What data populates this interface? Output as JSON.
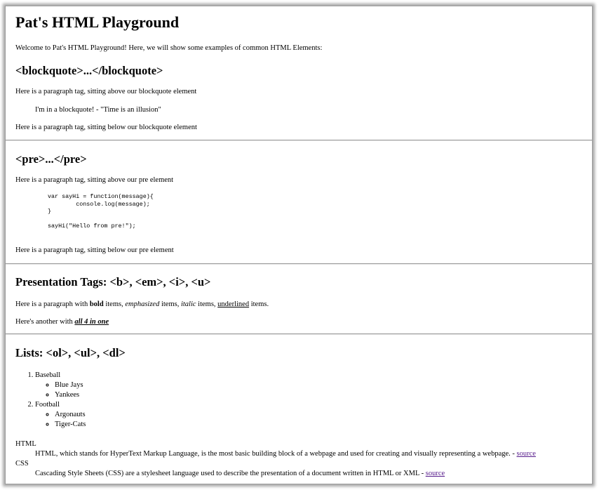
{
  "page": {
    "title": "Pat's HTML Playground",
    "intro": "Welcome to Pat's HTML Playground! Here, we will show some examples of common HTML Elements:"
  },
  "blockquote_section": {
    "heading": "<blockquote>...</blockquote>",
    "above": "Here is a paragraph tag, sitting above our blockquote element",
    "quote": "I'm in a blockquote! - \"Time is an illusion\"",
    "below": "Here is a paragraph tag, sitting below our blockquote element"
  },
  "pre_section": {
    "heading": "<pre>...</pre>",
    "above": "Here is a paragraph tag, sitting above our pre element",
    "code": "var sayHi = function(message){\n        console.log(message);\n}\n\nsayHi(\"Hello from pre!\");",
    "below": "Here is a paragraph tag, sitting below our pre element"
  },
  "presentation_section": {
    "heading": "Presentation Tags: <b>, <em>, <i>, <u>",
    "p1_start": "Here is a paragraph with ",
    "p1_bold": "bold",
    "p1_after_bold": " items, ",
    "p1_em": "emphasized",
    "p1_after_em": " items, ",
    "p1_italic": "italic",
    "p1_after_italic": " items, ",
    "p1_underline": "underlined",
    "p1_end": " items.",
    "p2_start": "Here's another with ",
    "p2_all": "all 4 in one"
  },
  "lists_section": {
    "heading": "Lists: <ol>, <ul>, <dl>",
    "ordered": [
      {
        "label": "Baseball",
        "items": [
          "Blue Jays",
          "Yankees"
        ]
      },
      {
        "label": "Football",
        "items": [
          "Argonauts",
          "Tiger-Cats"
        ]
      }
    ],
    "definitions": [
      {
        "term": "HTML",
        "desc": "HTML, which stands for HyperText Markup Language, is the most basic building block of a webpage and used for creating and visually representing a webpage. - ",
        "link": "source"
      },
      {
        "term": "CSS",
        "desc": "Cascading Style Sheets (CSS) are a stylesheet language used to describe the presentation of a document written in HTML or XML - ",
        "link": "source"
      }
    ]
  },
  "colors": {
    "link_visited": "#551a8b",
    "separator": "#9c9c9c",
    "frame_border": "#9a9a9a"
  }
}
